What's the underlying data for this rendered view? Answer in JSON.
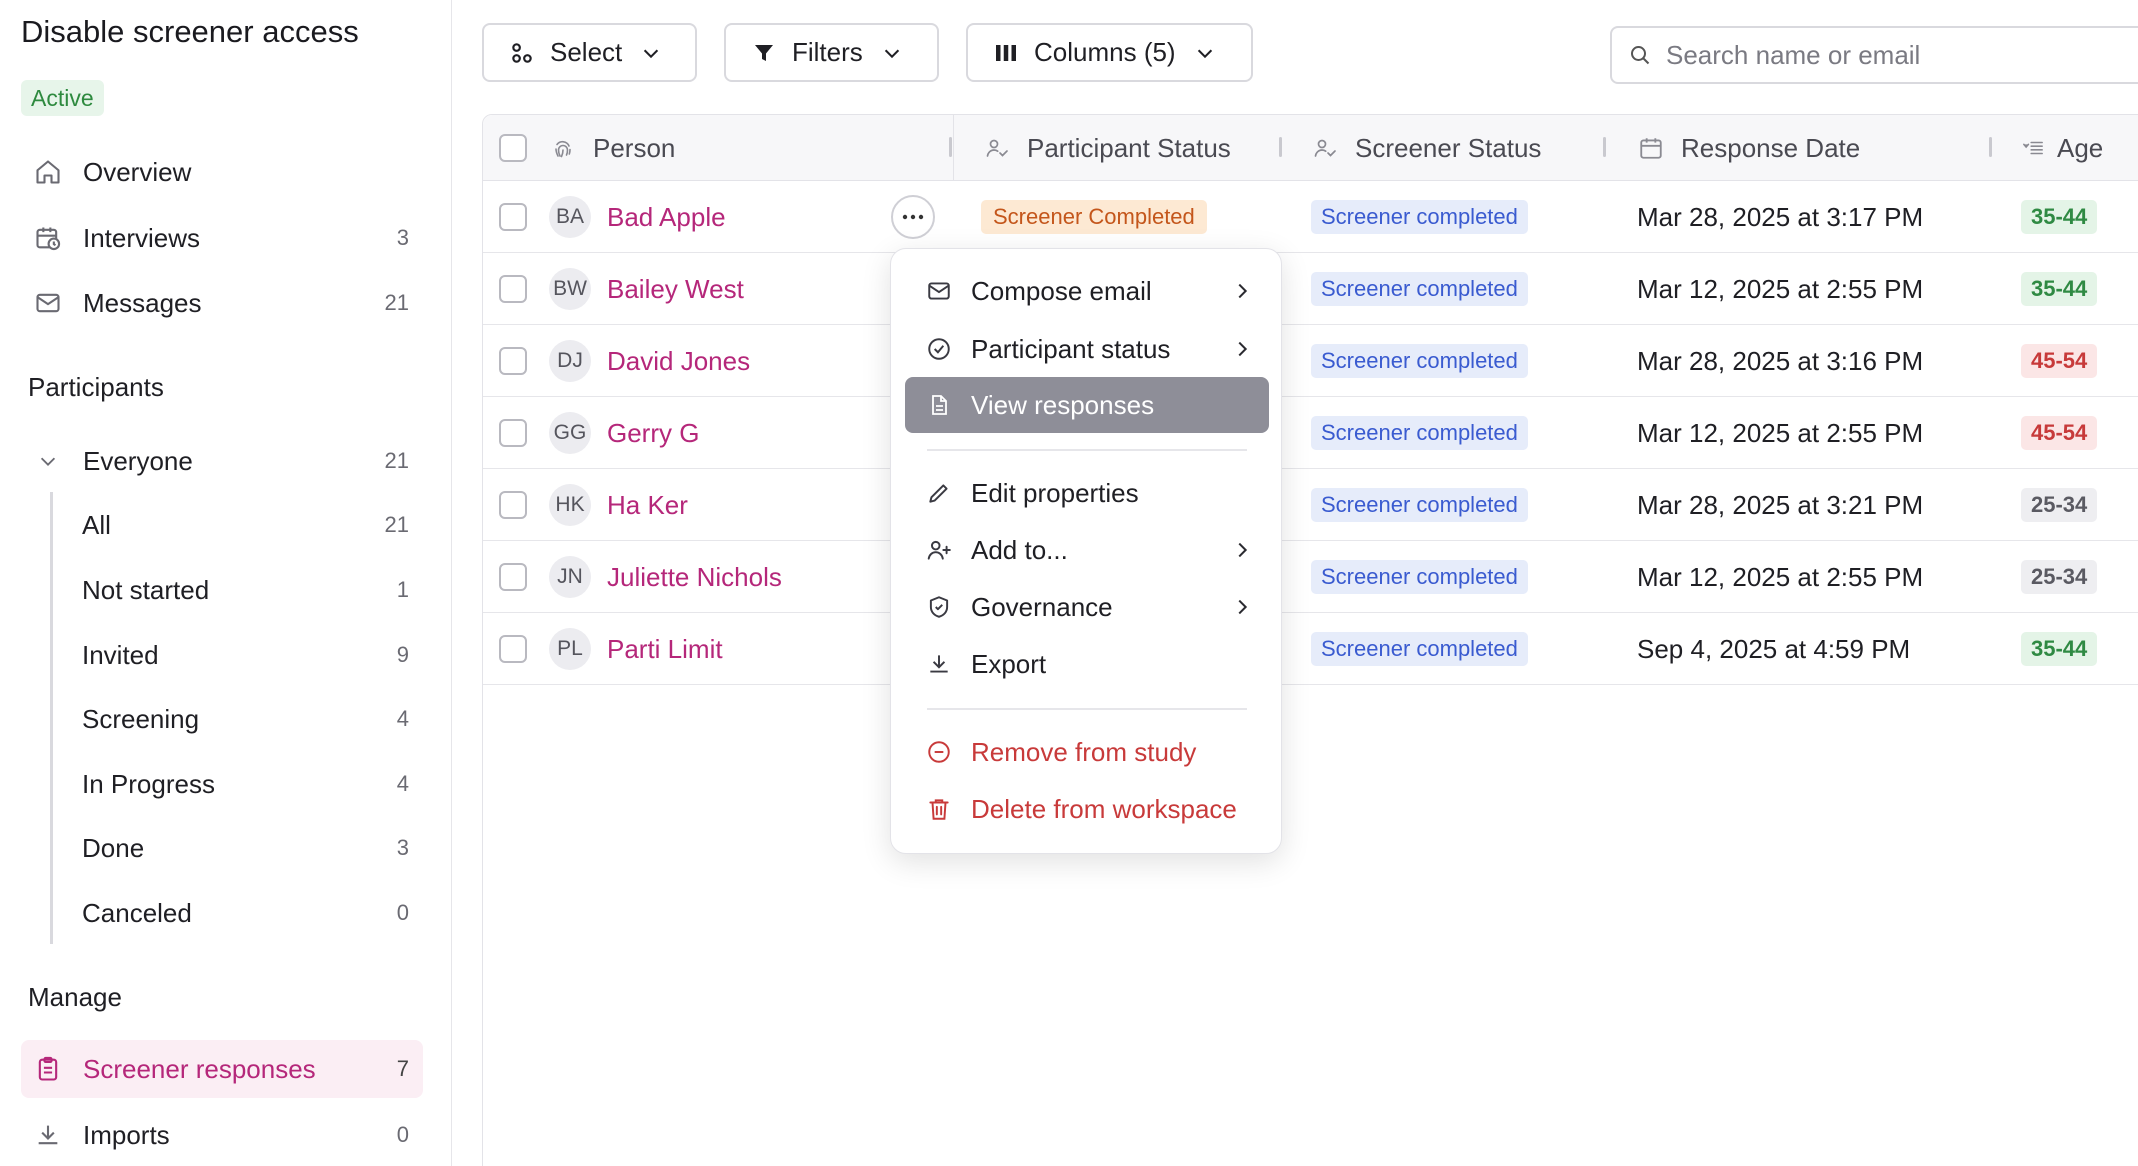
{
  "study": {
    "title": "Disable screener access",
    "status": "Active"
  },
  "nav": {
    "overview": {
      "label": "Overview"
    },
    "interviews": {
      "label": "Interviews",
      "count": "3"
    },
    "messages": {
      "label": "Messages",
      "count": "21"
    }
  },
  "participants": {
    "section": "Participants",
    "everyone": {
      "label": "Everyone",
      "count": "21"
    },
    "items": [
      {
        "label": "All",
        "count": "21"
      },
      {
        "label": "Not started",
        "count": "1"
      },
      {
        "label": "Invited",
        "count": "9"
      },
      {
        "label": "Screening",
        "count": "4"
      },
      {
        "label": "In Progress",
        "count": "4"
      },
      {
        "label": "Done",
        "count": "3"
      },
      {
        "label": "Canceled",
        "count": "0"
      }
    ]
  },
  "manage": {
    "section": "Manage",
    "screener": {
      "label": "Screener responses",
      "count": "7"
    },
    "imports": {
      "label": "Imports",
      "count": "0"
    }
  },
  "toolbar": {
    "select": "Select",
    "filters": "Filters",
    "columns": "Columns (5)",
    "search_placeholder": "Search name or email"
  },
  "table": {
    "headers": {
      "person": "Person",
      "participant_status": "Participant Status",
      "screener_status": "Screener Status",
      "response_date": "Response Date",
      "age": "Age"
    },
    "rows": [
      {
        "initials": "BA",
        "name": "Bad Apple",
        "participant_status": "Screener Completed",
        "screener_status": "Screener completed",
        "date": "Mar 28, 2025 at 3:17 PM",
        "age": "35-44",
        "age_color": "green"
      },
      {
        "initials": "BW",
        "name": "Bailey West",
        "participant_status": "",
        "screener_status": "Screener completed",
        "date": "Mar 12, 2025 at 2:55 PM",
        "age": "35-44",
        "age_color": "green"
      },
      {
        "initials": "DJ",
        "name": "David Jones",
        "participant_status": "",
        "screener_status": "Screener completed",
        "date": "Mar 28, 2025 at 3:16 PM",
        "age": "45-54",
        "age_color": "red"
      },
      {
        "initials": "GG",
        "name": "Gerry G",
        "participant_status": "",
        "screener_status": "Screener completed",
        "date": "Mar 12, 2025 at 2:55 PM",
        "age": "45-54",
        "age_color": "red"
      },
      {
        "initials": "HK",
        "name": "Ha Ker",
        "participant_status": "",
        "screener_status": "Screener completed",
        "date": "Mar 28, 2025 at 3:21 PM",
        "age": "25-34",
        "age_color": "gray"
      },
      {
        "initials": "JN",
        "name": "Juliette Nichols",
        "participant_status": "",
        "screener_status": "Screener completed",
        "date": "Mar 12, 2025 at 2:55 PM",
        "age": "25-34",
        "age_color": "gray"
      },
      {
        "initials": "PL",
        "name": "Parti Limit",
        "participant_status": "",
        "screener_status": "Screener completed",
        "date": "Sep 4, 2025 at 4:59 PM",
        "age": "35-44",
        "age_color": "green"
      }
    ]
  },
  "menu": {
    "compose_email": "Compose email",
    "participant_status": "Participant status",
    "view_responses": "View responses",
    "edit_properties": "Edit properties",
    "add_to": "Add to...",
    "governance": "Governance",
    "export": "Export",
    "remove_from_study": "Remove from study",
    "delete_from_workspace": "Delete from workspace"
  },
  "colors": {
    "accent": "#b5277a",
    "active_green": "#2e8a3f",
    "danger": "#c83a3a",
    "screener_blue": "#3a5bd0",
    "menu_highlight": "#8e8e98"
  }
}
